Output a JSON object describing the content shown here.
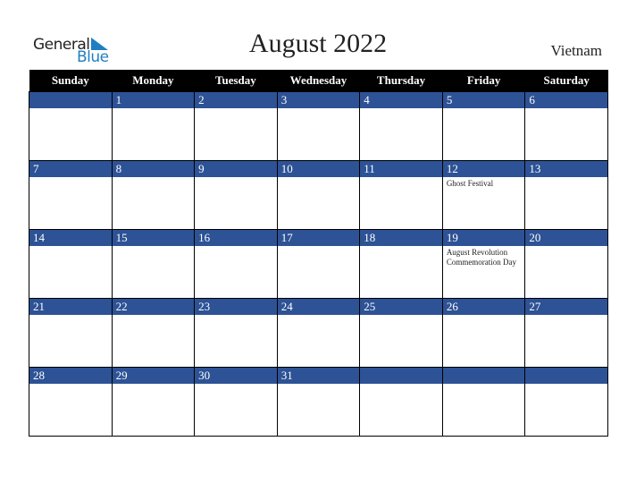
{
  "logo": {
    "line1": "General",
    "line2": "Blue"
  },
  "title": "August 2022",
  "country": "Vietnam",
  "weekdays": [
    "Sunday",
    "Monday",
    "Tuesday",
    "Wednesday",
    "Thursday",
    "Friday",
    "Saturday"
  ],
  "weeks": [
    [
      {
        "day": "",
        "event": ""
      },
      {
        "day": "1",
        "event": ""
      },
      {
        "day": "2",
        "event": ""
      },
      {
        "day": "3",
        "event": ""
      },
      {
        "day": "4",
        "event": ""
      },
      {
        "day": "5",
        "event": ""
      },
      {
        "day": "6",
        "event": ""
      }
    ],
    [
      {
        "day": "7",
        "event": ""
      },
      {
        "day": "8",
        "event": ""
      },
      {
        "day": "9",
        "event": ""
      },
      {
        "day": "10",
        "event": ""
      },
      {
        "day": "11",
        "event": ""
      },
      {
        "day": "12",
        "event": "Ghost Festival"
      },
      {
        "day": "13",
        "event": ""
      }
    ],
    [
      {
        "day": "14",
        "event": ""
      },
      {
        "day": "15",
        "event": ""
      },
      {
        "day": "16",
        "event": ""
      },
      {
        "day": "17",
        "event": ""
      },
      {
        "day": "18",
        "event": ""
      },
      {
        "day": "19",
        "event": "August Revolution Commemoration Day"
      },
      {
        "day": "20",
        "event": ""
      }
    ],
    [
      {
        "day": "21",
        "event": ""
      },
      {
        "day": "22",
        "event": ""
      },
      {
        "day": "23",
        "event": ""
      },
      {
        "day": "24",
        "event": ""
      },
      {
        "day": "25",
        "event": ""
      },
      {
        "day": "26",
        "event": ""
      },
      {
        "day": "27",
        "event": ""
      }
    ],
    [
      {
        "day": "28",
        "event": ""
      },
      {
        "day": "29",
        "event": ""
      },
      {
        "day": "30",
        "event": ""
      },
      {
        "day": "31",
        "event": ""
      },
      {
        "day": "",
        "event": ""
      },
      {
        "day": "",
        "event": ""
      },
      {
        "day": "",
        "event": ""
      }
    ]
  ]
}
